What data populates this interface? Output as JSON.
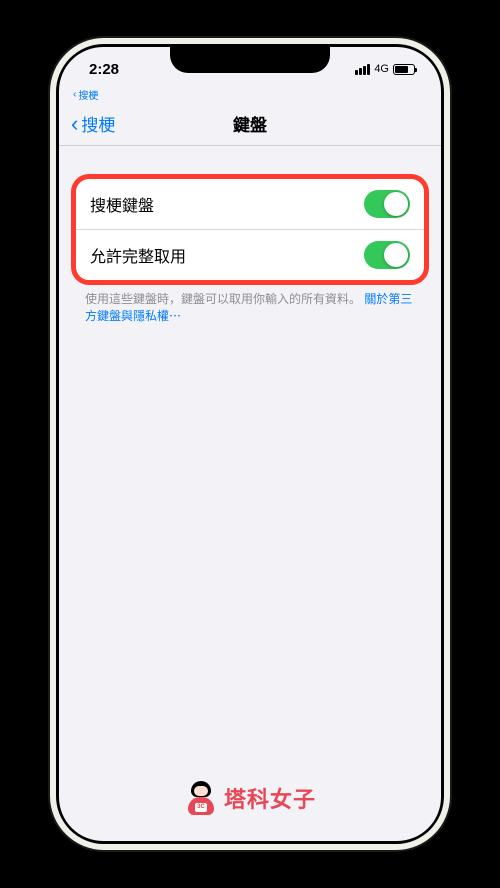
{
  "status": {
    "time": "2:28",
    "breadcrumb": "搜梗",
    "network": "4G"
  },
  "nav": {
    "back_label": "搜梗",
    "title": "鍵盤"
  },
  "settings": {
    "rows": [
      {
        "label": "搜梗鍵盤",
        "enabled": true
      },
      {
        "label": "允許完整取用",
        "enabled": true
      }
    ],
    "footer_text": "使用這些鍵盤時，鍵盤可以取用你輸入的所有資料。",
    "footer_link": "關於第三方鍵盤與隱私權⋯"
  },
  "watermark": {
    "badge": "3C",
    "text": "塔科女子"
  },
  "colors": {
    "accent": "#007aff",
    "toggle_on": "#34c759",
    "highlight": "#ff3b30",
    "brand": "#e84855"
  }
}
